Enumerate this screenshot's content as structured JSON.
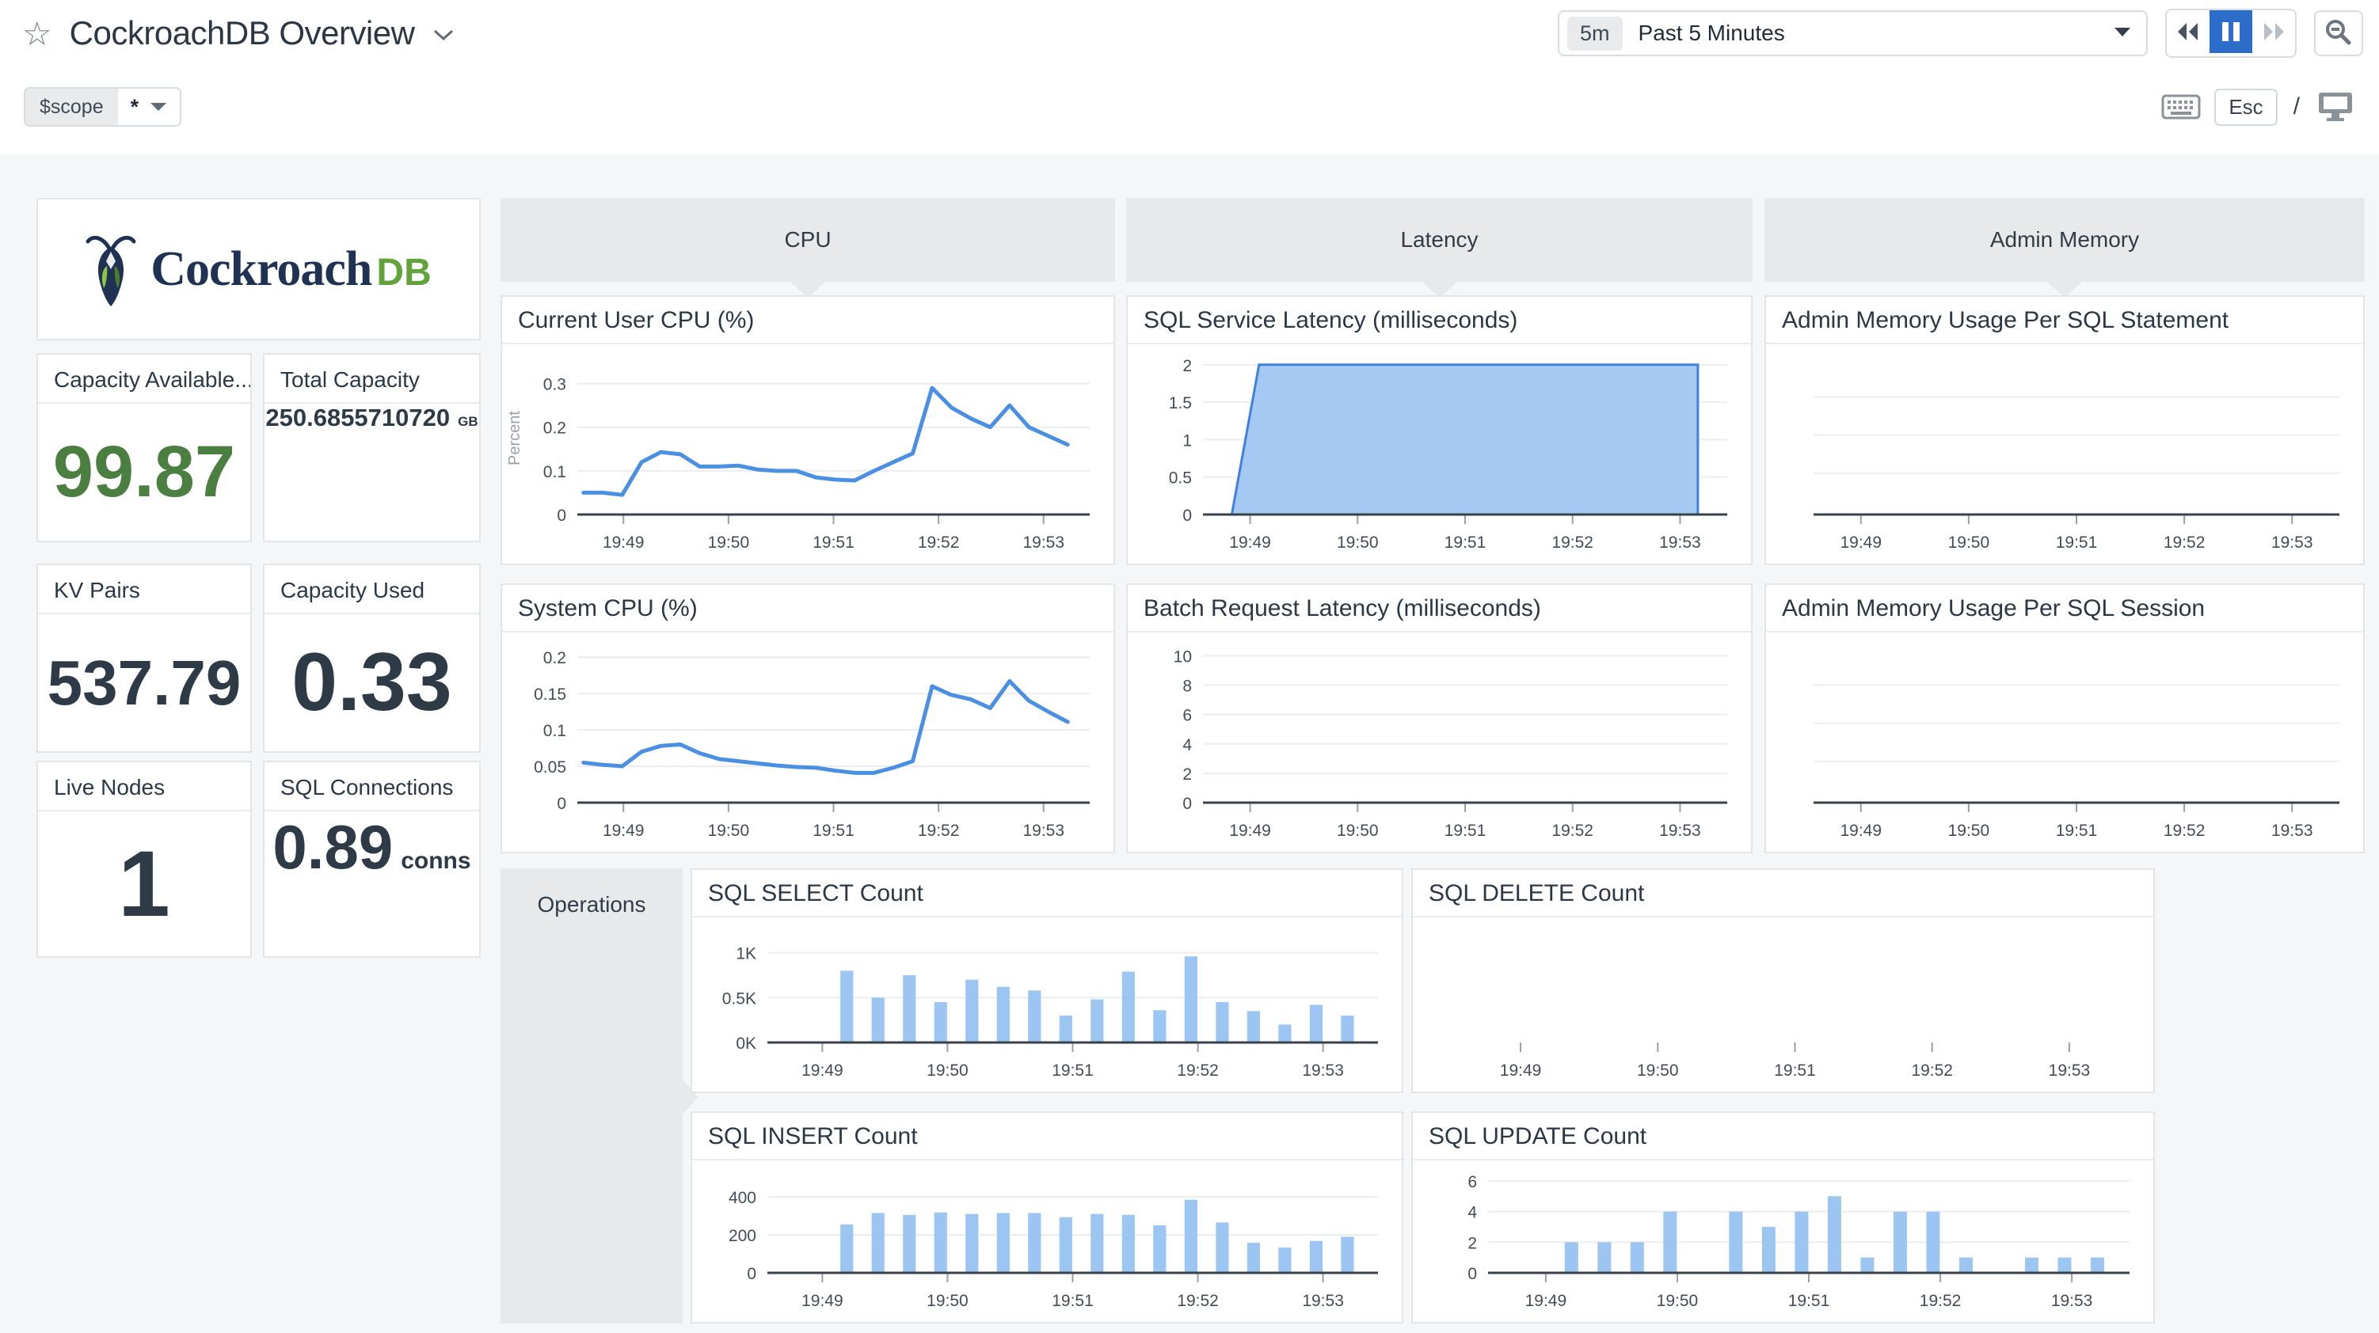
{
  "header": {
    "title": "CockroachDB Overview",
    "time_badge": "5m",
    "time_label": "Past 5 Minutes"
  },
  "scope_bar": {
    "variable": "$scope",
    "value": "*",
    "esc": "Esc",
    "slash": "/"
  },
  "logo": {
    "brand": "Cockroach",
    "suffix": "DB"
  },
  "stats": {
    "capacity_available": {
      "label": "Capacity Available...",
      "value": "99.87"
    },
    "total_capacity": {
      "label": "Total Capacity",
      "value": "250.6855710720",
      "unit": "GB"
    },
    "kv_pairs": {
      "label": "KV Pairs",
      "value": "537.79"
    },
    "capacity_used": {
      "label": "Capacity Used",
      "value": "0.33"
    },
    "live_nodes": {
      "label": "Live Nodes",
      "value": "1"
    },
    "sql_connections": {
      "label": "SQL Connections",
      "value": "0.89",
      "unit": "conns"
    }
  },
  "groups": {
    "cpu": "CPU",
    "latency": "Latency",
    "admin_memory": "Admin Memory",
    "operations": "Operations"
  },
  "colors": {
    "line_blue": "#4b8fe2",
    "bar_blue": "#9cc6f1",
    "area_fill": "#a5c9f3",
    "area_stroke": "#3f80e0",
    "grid": "#ebedee",
    "axis": "#39424b",
    "tick_text": "#434c55",
    "tick_mark": "#9aa0a6",
    "muted": "#9aa2a9",
    "accent_blue": "#2c6dc9",
    "green": "#4b7e41",
    "logo_navy": "#1f3254",
    "logo_green": "#63a33c"
  },
  "chart_data": [
    {
      "id": "current-user-cpu",
      "title": "Current User CPU (%)",
      "type": "line",
      "ylabel": "Percent",
      "ymax": 0.35,
      "yticks": [
        [
          0,
          "0"
        ],
        [
          0.1,
          "0.1"
        ],
        [
          0.2,
          "0.2"
        ],
        [
          0.3,
          "0.3"
        ]
      ],
      "xticks": [
        "19:49",
        "19:50",
        "19:51",
        "19:52",
        "19:53"
      ],
      "values": [
        0.05,
        0.05,
        0.045,
        0.12,
        0.143,
        0.138,
        0.11,
        0.11,
        0.112,
        0.103,
        0.1,
        0.1,
        0.085,
        0.08,
        0.078,
        0.1,
        0.12,
        0.14,
        0.29,
        0.245,
        0.22,
        0.2,
        0.25,
        0.2,
        0.18,
        0.16
      ]
    },
    {
      "id": "system-cpu",
      "title": "System CPU (%)",
      "type": "line",
      "ymax": 0.21,
      "yticks": [
        [
          0,
          "0"
        ],
        [
          0.05,
          "0.05"
        ],
        [
          0.1,
          "0.1"
        ],
        [
          0.15,
          "0.15"
        ],
        [
          0.2,
          "0.2"
        ]
      ],
      "xticks": [
        "19:49",
        "19:50",
        "19:51",
        "19:52",
        "19:53"
      ],
      "values": [
        0.055,
        0.052,
        0.05,
        0.07,
        0.078,
        0.08,
        0.068,
        0.06,
        0.057,
        0.054,
        0.051,
        0.049,
        0.048,
        0.044,
        0.041,
        0.041,
        0.048,
        0.057,
        0.16,
        0.148,
        0.142,
        0.13,
        0.167,
        0.14,
        0.125,
        0.111
      ]
    },
    {
      "id": "sql-service-latency",
      "title": "SQL Service Latency (milliseconds)",
      "type": "area",
      "ymax": 2.04,
      "yticks": [
        [
          0,
          "0"
        ],
        [
          0.5,
          "0.5"
        ],
        [
          1,
          "1"
        ],
        [
          1.5,
          "1.5"
        ],
        [
          2,
          "2"
        ]
      ],
      "xticks": [
        "19:49",
        "19:50",
        "19:51",
        "19:52",
        "19:53"
      ],
      "points": [
        [
          0.055,
          0
        ],
        [
          0.107,
          2
        ],
        [
          0.944,
          2
        ],
        [
          0.944,
          0
        ]
      ]
    },
    {
      "id": "batch-request-latency",
      "title": "Batch Request Latency (milliseconds)",
      "type": "line",
      "ymax": 10.4,
      "yticks": [
        [
          0,
          "0"
        ],
        [
          2,
          "2"
        ],
        [
          4,
          "4"
        ],
        [
          6,
          "6"
        ],
        [
          8,
          "8"
        ],
        [
          10,
          "10"
        ]
      ],
      "xticks": [
        "19:49",
        "19:50",
        "19:51",
        "19:52",
        "19:53"
      ],
      "values": []
    },
    {
      "id": "admin-memory-per-sql-statement",
      "title": "Admin Memory Usage Per SQL Statement",
      "type": "line",
      "ymax": 1,
      "yticks": [
        [
          0.27,
          ""
        ],
        [
          0.52,
          ""
        ],
        [
          0.77,
          ""
        ]
      ],
      "xticks": [
        "19:49",
        "19:50",
        "19:51",
        "19:52",
        "19:53"
      ],
      "values": []
    },
    {
      "id": "admin-memory-per-sql-session",
      "title": "Admin Memory Usage Per SQL Session",
      "type": "line",
      "ymax": 1,
      "yticks": [
        [
          0.27,
          ""
        ],
        [
          0.52,
          ""
        ],
        [
          0.77,
          ""
        ]
      ],
      "xticks": [
        "19:49",
        "19:50",
        "19:51",
        "19:52",
        "19:53"
      ],
      "values": []
    },
    {
      "id": "sql-select-count",
      "title": "SQL SELECT Count",
      "type": "bar",
      "ymax": 1200,
      "yticks": [
        [
          0,
          "0K"
        ],
        [
          500,
          "0.5K"
        ],
        [
          1000,
          "1K"
        ]
      ],
      "xticks": [
        "19:49",
        "19:50",
        "19:51",
        "19:52",
        "19:53"
      ],
      "values": [
        800,
        500,
        750,
        450,
        700,
        620,
        580,
        300,
        480,
        790,
        360,
        960,
        450,
        350,
        200,
        420,
        300
      ]
    },
    {
      "id": "sql-delete-count",
      "title": "SQL DELETE Count",
      "type": "bar",
      "ymax": 1,
      "yticks": [],
      "xticks": [
        "19:49",
        "19:50",
        "19:51",
        "19:52",
        "19:53"
      ],
      "values": [],
      "axis_line": false
    },
    {
      "id": "sql-insert-count",
      "title": "SQL INSERT Count",
      "type": "bar",
      "ymax": 500,
      "yticks": [
        [
          0,
          "0"
        ],
        [
          200,
          "200"
        ],
        [
          400,
          "400"
        ]
      ],
      "xticks": [
        "19:49",
        "19:50",
        "19:51",
        "19:52",
        "19:53"
      ],
      "values": [
        255,
        315,
        305,
        318,
        310,
        315,
        315,
        293,
        310,
        305,
        250,
        385,
        265,
        158,
        133,
        168,
        190
      ]
    },
    {
      "id": "sql-update-count",
      "title": "SQL UPDATE Count",
      "type": "bar",
      "ymax": 6.2,
      "yticks": [
        [
          0,
          "0"
        ],
        [
          2,
          "2"
        ],
        [
          4,
          "4"
        ],
        [
          6,
          "6"
        ]
      ],
      "xticks": [
        "19:49",
        "19:50",
        "19:51",
        "19:52",
        "19:53"
      ],
      "values": [
        2,
        2,
        2,
        4,
        0,
        4,
        3,
        4,
        5,
        1,
        4,
        4,
        1,
        0,
        1,
        1,
        1
      ]
    }
  ]
}
